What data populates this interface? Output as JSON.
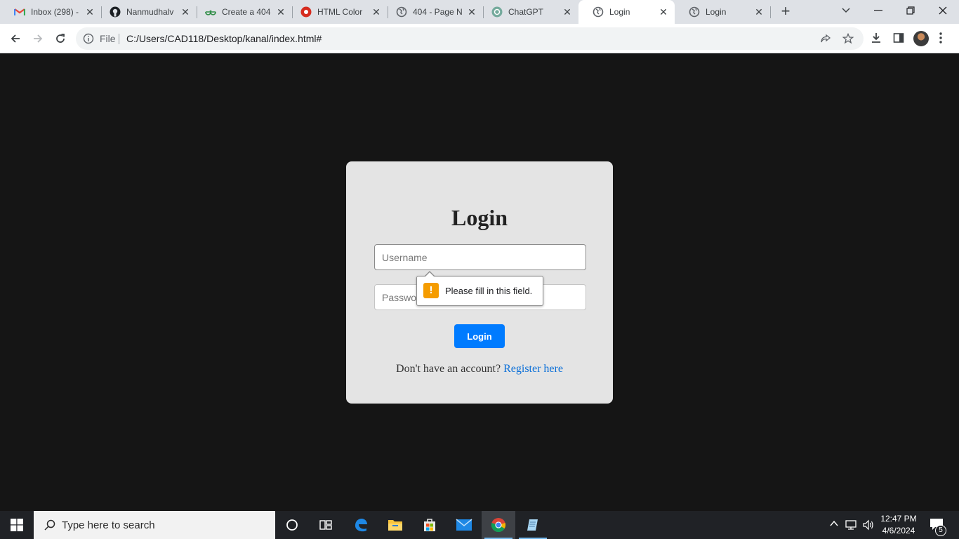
{
  "browser": {
    "tabs": [
      {
        "title": "Inbox (298) -",
        "icon": "gmail-icon"
      },
      {
        "title": "Nanmudhalv",
        "icon": "github-icon"
      },
      {
        "title": "Create a 404",
        "icon": "geeksforgeeks-icon"
      },
      {
        "title": "HTML Color",
        "icon": "color-picker-icon"
      },
      {
        "title": "404 - Page N",
        "icon": "globe-icon"
      },
      {
        "title": "ChatGPT",
        "icon": "chatgpt-icon"
      },
      {
        "title": "Login",
        "icon": "globe-icon",
        "active": true
      },
      {
        "title": "Login",
        "icon": "globe-icon"
      }
    ],
    "omnibox": {
      "scheme_chip": "File",
      "url": "C:/Users/CAD118/Desktop/kanal/index.html#"
    }
  },
  "login": {
    "title": "Login",
    "username_placeholder": "Username",
    "password_placeholder": "Password",
    "button_label": "Login",
    "register_prompt": "Don't have an account?",
    "register_link": "Register here",
    "validation_message": "Please fill in this field."
  },
  "taskbar": {
    "search_placeholder": "Type here to search",
    "apps": [
      "cortana-icon",
      "task-view-icon",
      "edge-icon",
      "file-explorer-icon",
      "microsoft-store-icon",
      "mail-icon",
      "chrome-icon",
      "notepad-icon"
    ],
    "clock_time": "12:47 PM",
    "clock_date": "4/6/2024",
    "notification_count": "5"
  },
  "colors": {
    "page_background": "#151515",
    "card_background": "#e4e4e4",
    "button_primary": "#007bff",
    "link": "#0a6fd8",
    "warning": "#f59c00"
  }
}
